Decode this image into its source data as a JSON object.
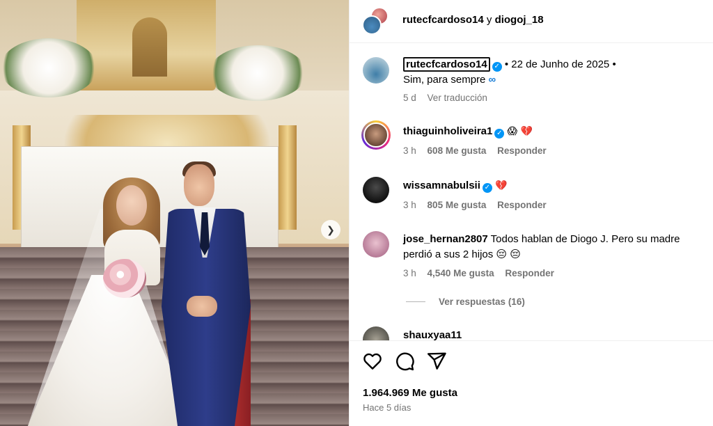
{
  "header": {
    "user1": "rutecfcardoso14",
    "connector": "y",
    "user2": "diogoj_18"
  },
  "caption": {
    "username": "rutecfcardoso14",
    "date": "• 22 de Junho de 2025 •",
    "text": "Sim, para sempre",
    "symbol": "∞",
    "age": "5 d",
    "translate": "Ver traducción"
  },
  "comments": [
    {
      "username": "thiaguinholiveira1",
      "verified": true,
      "text": "😱 💔",
      "age": "3 h",
      "likes": "608 Me gusta",
      "reply": "Responder"
    },
    {
      "username": "wissamnabulsii",
      "verified": true,
      "text": "💔",
      "age": "3 h",
      "likes": "805 Me gusta",
      "reply": "Responder"
    },
    {
      "username": "jose_hernan2807",
      "verified": false,
      "text_line1": "Todos hablan de Diogo J. Pero su madre",
      "text_line2": "perdió a sus 2 hijos 😔 😔",
      "age": "3 h",
      "likes": "4,540 Me gusta",
      "reply": "Responder",
      "view_replies": "Ver respuestas (16)"
    },
    {
      "username": "shauxyaa11"
    }
  ],
  "actions": {
    "icons": [
      "heart-icon",
      "comment-icon",
      "share-icon"
    ],
    "likes": "1.964.969 Me gusta",
    "posted": "Hace 5 días"
  },
  "colors": {
    "verified": "#0095f6",
    "secondary_text": "#737373",
    "divider": "#efefef"
  }
}
